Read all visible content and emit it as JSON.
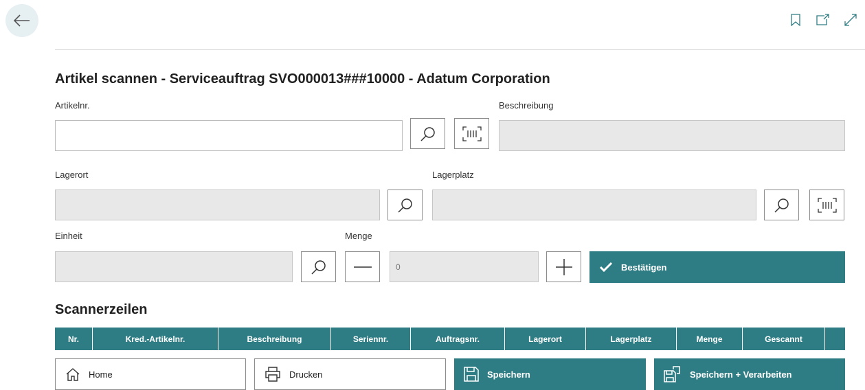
{
  "title": "Artikel scannen - Serviceauftrag SVO000013###10000 - Adatum Corporation",
  "fields": {
    "artikelnr": {
      "label": "Artikelnr.",
      "value": ""
    },
    "beschreibung": {
      "label": "Beschreibung",
      "value": ""
    },
    "lagerort": {
      "label": "Lagerort",
      "value": ""
    },
    "lagerplatz": {
      "label": "Lagerplatz",
      "value": ""
    },
    "einheit": {
      "label": "Einheit",
      "value": ""
    },
    "menge": {
      "label": "Menge",
      "value": "0"
    }
  },
  "confirm_label": "Bestätigen",
  "section_title": "Scannerzeilen",
  "table": {
    "columns": [
      "Nr.",
      "Kred.-Artikelnr.",
      "Beschreibung",
      "Seriennr.",
      "Auftragsnr.",
      "Lagerort",
      "Lagerplatz",
      "Menge",
      "Gescannt",
      ""
    ]
  },
  "footer": {
    "home": "Home",
    "print": "Drucken",
    "save": "Speichern",
    "save_process": "Speichern + Verarbeiten"
  },
  "colors": {
    "accent": "#2f7d84",
    "readonly": "#e8e8e8"
  },
  "icons": [
    "back-arrow-icon",
    "bookmark-icon",
    "open-new-window-icon",
    "expand-icon",
    "search-icon",
    "barcode-scan-icon",
    "minus-icon",
    "plus-icon",
    "checkmark-icon",
    "home-icon",
    "printer-icon",
    "save-icon",
    "save-process-icon"
  ]
}
